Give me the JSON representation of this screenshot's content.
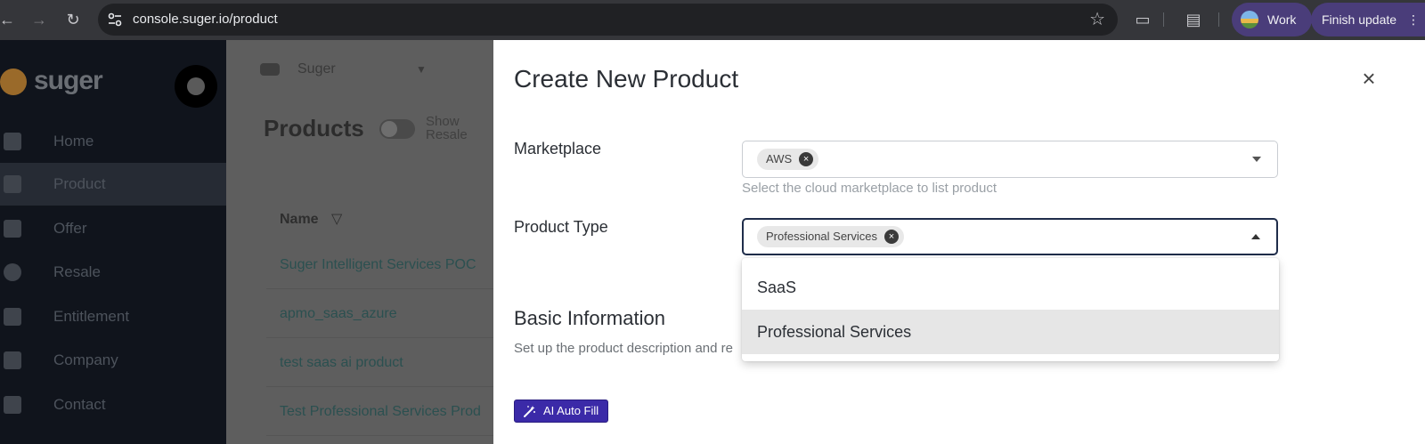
{
  "browser": {
    "url": "console.suger.io/product",
    "profile_label": "Work",
    "update_label": "Finish update",
    "icons": [
      "back-icon",
      "forward-icon",
      "reload-icon",
      "site-settings-icon",
      "bookmark-star-icon",
      "extensions-icon",
      "media-icon",
      "more-icon"
    ]
  },
  "sidebar": {
    "logo_text": "suger",
    "items": [
      {
        "label": "Home",
        "icon": "home-icon"
      },
      {
        "label": "Product",
        "icon": "grid-icon",
        "active": true
      },
      {
        "label": "Offer",
        "icon": "offer-icon"
      },
      {
        "label": "Resale",
        "icon": "resale-icon"
      },
      {
        "label": "Entitlement",
        "icon": "document-icon"
      },
      {
        "label": "Company",
        "icon": "people-icon"
      },
      {
        "label": "Contact",
        "icon": "contact-icon"
      }
    ]
  },
  "main": {
    "org_name": "Suger",
    "title": "Products",
    "show_resale_label": "Show Resale",
    "name_column": "Name",
    "rows": [
      "Suger Intelligent Services POC",
      "apmo_saas_azure",
      "test saas ai product",
      "Test Professional Services Prod"
    ]
  },
  "drawer": {
    "title": "Create New Product",
    "marketplace": {
      "label": "Marketplace",
      "chip": "AWS",
      "helper": "Select the cloud marketplace to list product"
    },
    "product_type": {
      "label": "Product Type",
      "chip": "Professional Services",
      "options": [
        "SaaS",
        "Professional Services"
      ],
      "selected": "Professional Services"
    },
    "basic_info": {
      "title": "Basic Information",
      "subtitle": "Set up the product description and re"
    },
    "ai_button": "AI Auto Fill"
  }
}
